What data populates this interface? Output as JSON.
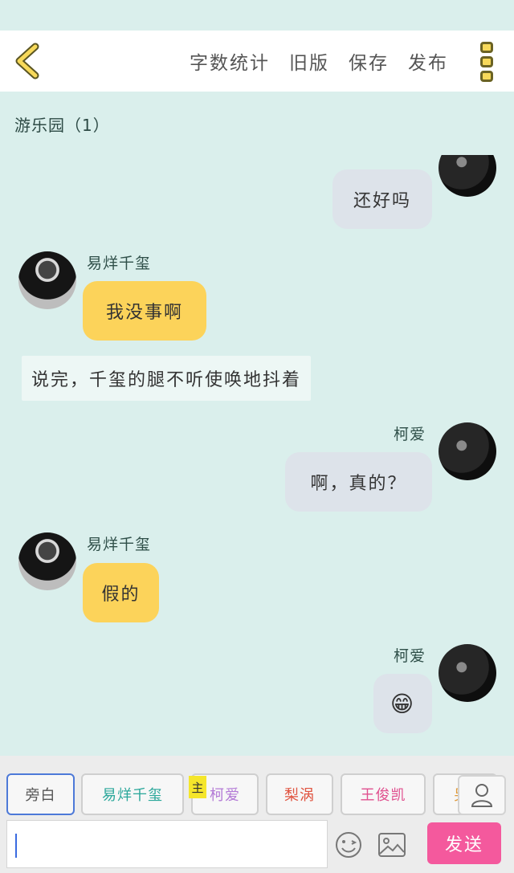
{
  "toolbar": {
    "word_count": "字数统计",
    "old_version": "旧版",
    "save": "保存",
    "publish": "发布"
  },
  "chapter": {
    "title": "游乐园（1）"
  },
  "messages": [
    {
      "side": "right",
      "speaker": "柯爱",
      "text": "还好吗"
    },
    {
      "side": "left",
      "speaker": "易烊千玺",
      "text": "我没事啊"
    },
    {
      "side": "narration",
      "text": "说完，千玺的腿不听使唤地抖着"
    },
    {
      "side": "right",
      "speaker": "柯爱",
      "text": "啊，真的？"
    },
    {
      "side": "left",
      "speaker": "易烊千玺",
      "text": "假的"
    },
    {
      "side": "right",
      "speaker": "柯爱",
      "text": "😁"
    }
  ],
  "roles": [
    {
      "label": "旁白",
      "color": "#555555"
    },
    {
      "label": "易烊千玺",
      "color": "#2aa79a"
    },
    {
      "label": "柯爱",
      "color": "#b37ad6"
    },
    {
      "label": "梨涡",
      "color": "#e0533f"
    },
    {
      "label": "王俊凯",
      "color": "#e0508f"
    },
    {
      "label": "另",
      "color": "#e09a3a"
    }
  ],
  "main_tag": "主",
  "input": {
    "value": "",
    "placeholder": ""
  },
  "send_label": "发送",
  "colors": {
    "accent_bubble_left": "#fcd35a",
    "bubble_right": "#dde3ea",
    "send": "#f4599d",
    "background": "#daefec"
  },
  "icons": [
    "back-arrow-icon",
    "menu-dots-icon",
    "emoji-icon",
    "image-icon",
    "profile-icon"
  ]
}
